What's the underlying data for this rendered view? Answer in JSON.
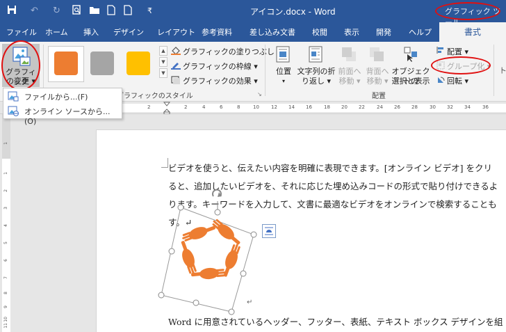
{
  "titlebar": {
    "doc_title": "アイコン.docx - Word",
    "context_tool": "グラフィック ツール"
  },
  "tabs": [
    "ファイル",
    "ホーム",
    "挿入",
    "デザイン",
    "レイアウト",
    "参考資料",
    "差し込み文書",
    "校閲",
    "表示",
    "開発",
    "ヘルプ",
    "書式"
  ],
  "ribbon": {
    "change_graphic": {
      "line1": "グラフィック",
      "line2": "の変更 ▾"
    },
    "styles_group_label": "グラフィックのスタイル",
    "fill_label": "グラフィックの塗りつぶし ▾",
    "outline_label": "グラフィックの枠線 ▾",
    "effects_label": "グラフィックの効果 ▾",
    "swatch_colors": [
      "#ed7d31",
      "#a5a5a5",
      "#ffc000"
    ],
    "position": "位置",
    "wrap_line1": "文字列の折",
    "wrap_line2": "り返し ▾",
    "forward_line1": "前面へ",
    "forward_line2": "移動 ▾",
    "backward_line1": "背面へ",
    "backward_line2": "移動 ▾",
    "selection_line1": "オブジェクトの",
    "selection_line2": "選択と表示",
    "align": "配置 ▾",
    "group": "グループ化 ▾",
    "rotate": "回転 ▾",
    "arrange_group_label": "配置"
  },
  "menu": {
    "from_file": "ファイルから...(F)",
    "from_online": "オンライン ソースから...(O)"
  },
  "ruler": {
    "ticks": [
      "2",
      "2",
      "4",
      "6",
      "8",
      "10",
      "12",
      "14",
      "16",
      "18",
      "20",
      "22",
      "24",
      "26",
      "28",
      "30",
      "32",
      "34",
      "36"
    ],
    "vticks": [
      "1",
      "1",
      "2",
      "3",
      "4",
      "5",
      "6",
      "7",
      "8",
      "9",
      "10",
      "11"
    ]
  },
  "document": {
    "p1_line1": "ビデオを使うと、伝えたい内容を明確に表現できます。[オンライン ビデオ] をクリ",
    "p1_line2": "ると、追加したいビデオを、それに応じた埋め込みコードの形式で貼り付けできるよ",
    "p1_line3": "ります。キーワードを入力して、文書に最適なビデオをオンラインで検索することも",
    "p1_line4": "す。↵",
    "p2_line1": "Word に用意されているヘッダー、フッター、表紙、テキスト ボックス デザインを組",
    "para_mark": "↵"
  },
  "colors": {
    "title_bar": "#2b579a",
    "ribbon_bg": "#f3f3f3",
    "annotation_red": "#e01010",
    "hands_orange": "#ed7d31"
  }
}
